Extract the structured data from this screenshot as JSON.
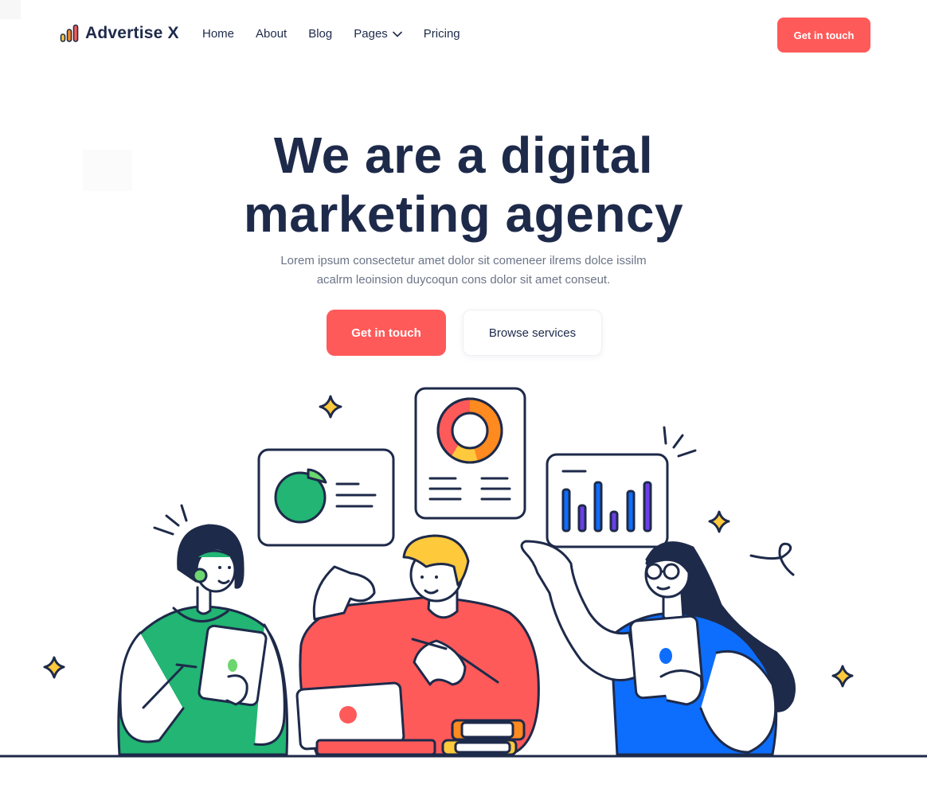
{
  "brand": {
    "name": "Advertise X",
    "logo_icon": "bar-chart-logo-icon"
  },
  "nav": {
    "items": [
      {
        "label": "Home"
      },
      {
        "label": "About"
      },
      {
        "label": "Blog"
      },
      {
        "label": "Pages",
        "has_dropdown": true,
        "icon": "chevron-down-icon"
      },
      {
        "label": "Pricing"
      }
    ],
    "cta_label": "Get in touch"
  },
  "hero": {
    "title_line1": "We are a digital",
    "title_line2": "marketing agency",
    "subtitle_line1": "Lorem ipsum consectetur amet dolor sit comeneer ilrems dolce issilm",
    "subtitle_line2": "acalrm leoinsion duycoqun cons dolor sit amet conseut.",
    "primary_button": "Get in touch",
    "secondary_button": "Browse services"
  },
  "colors": {
    "primary": "#ff5a5a",
    "navy": "#1e2a4a",
    "green": "#22b573",
    "blue": "#0d6efd",
    "orange": "#ff8a1f",
    "yellow": "#ffc93c",
    "purple": "#6b3fe8"
  }
}
